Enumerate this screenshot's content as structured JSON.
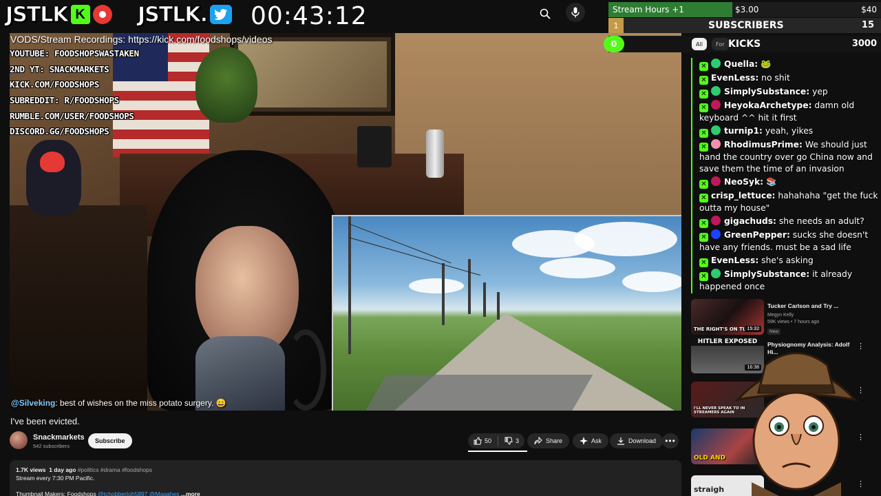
{
  "header": {
    "logo1_text": "JSTLK",
    "logo1_k": "K",
    "logo2_text": "JSTLK.",
    "timer": "00:43:12",
    "search_icon": "search-icon",
    "mic_icon": "mic-icon"
  },
  "video_overlay": {
    "vod_line": "VODS/Stream Recordings: https://kick.com/foodshops/videos",
    "socials": [
      "YOUTUBE: FOODSHOPSWASTAKEN",
      "2ND YT: SNACKMARKETS",
      "KICK.COM/FOODSHOPS",
      "SUBREDDIT: R/FOODSHOPS",
      "RUMBLE.COM/USER/FOODSHOPS",
      "DISCORD.GG/FOODSHOPS"
    ],
    "chat_user": "@Silveking",
    "chat_text": ": best of wishes on the miss potato surgery. 😄"
  },
  "video": {
    "title": "I've been evicted.",
    "channel": "Snackmarkets",
    "subscribers": "542 subscribers",
    "subscribe_label": "Subscribe",
    "likes": "50",
    "dislikes": "3",
    "share_label": "Share",
    "ask_label": "Ask",
    "download_label": "Download",
    "more_icon": "more-icon"
  },
  "description": {
    "views": "1.7K views",
    "age": "1 day ago",
    "tags": "#politics #drama #foodshops",
    "line2": "Stream every 7:30 PM Pacific.",
    "thumb_label": "Thumbnail Makers: Foodshops",
    "mention1": "@tchobbertoh5897",
    "mention2": "@Magahes",
    "more_label": "...more"
  },
  "stream_stats": {
    "hours_label": "Stream Hours +1",
    "hours_amount": "$3.00",
    "hours_goal": "$40",
    "hours_progress": 0.075,
    "subs_number": "1",
    "subs_label": "SUBSCRIBERS",
    "subs_count": "15",
    "kicks_value": "0",
    "chip_all": "All",
    "chip_for": "For",
    "kicks_label": "KICKS",
    "kicks_count": "3000",
    "accent": "#53fc18"
  },
  "chat": [
    {
      "user": "Quella:",
      "text": "🐸",
      "badge_color": "#2ecc71"
    },
    {
      "user": "EvenLess:",
      "text": "no shit",
      "badge_color": ""
    },
    {
      "user": "SimplySubstance:",
      "text": "yep",
      "badge_color": "#2ecc71"
    },
    {
      "user": "HeyokaArchetype:",
      "text": "damn old keyboard ^^ hit it first",
      "badge_color": "#c2185b"
    },
    {
      "user": "turnip1:",
      "text": "yeah, yikes",
      "badge_color": "#2ecc71"
    },
    {
      "user": "RhodimusPrime:",
      "text": "We should just hand the country over go China now and save them the time of an invasion",
      "badge_color": "#f48fb1"
    },
    {
      "user": "NeoSyk:",
      "text": "📚",
      "badge_color": "#c2185b"
    },
    {
      "user": "crisp_lettuce:",
      "text": "hahahaha \"get the fuck outta my house\"",
      "badge_color": ""
    },
    {
      "user": "gigachuds:",
      "text": "she needs an adult?",
      "badge_color": "#c2185b"
    },
    {
      "user": "GreenPepper:",
      "text": "sucks she doesn't have any friends. must be a sad life",
      "badge_color": "#1e40ff"
    },
    {
      "user": "EvenLess:",
      "text": "she's asking",
      "badge_color": ""
    },
    {
      "user": "SimplySubstance:",
      "text": "it already happened once",
      "badge_color": "#2ecc71"
    }
  ],
  "recommendations": [
    {
      "title": "Tucker Carlson and Try ...",
      "channel": "Megyn Kelly",
      "meta": "59K views • 7 hours ago",
      "duration": "15:32",
      "badge": "New",
      "thumb_caption": "THE RIGHT'S ON TUCKER"
    },
    {
      "title": "Physiognomy Analysis: Adolf Hi...",
      "channel": "",
      "meta": "",
      "duration": "16:38",
      "badge": "",
      "thumb_caption": "HITLER EXPOSED"
    },
    {
      "title": "",
      "channel": "",
      "meta": "",
      "duration": "",
      "badge": "",
      "thumb_caption": "I'LL NEVER SPEAK TO IN STREAMERS AGAIN"
    },
    {
      "title": "",
      "channel": "",
      "meta": "",
      "duration": "",
      "badge": "",
      "thumb_caption": "OLD AND"
    },
    {
      "title": "",
      "channel": "",
      "meta": "",
      "duration": "",
      "badge": "",
      "thumb_caption": "straigh"
    }
  ]
}
